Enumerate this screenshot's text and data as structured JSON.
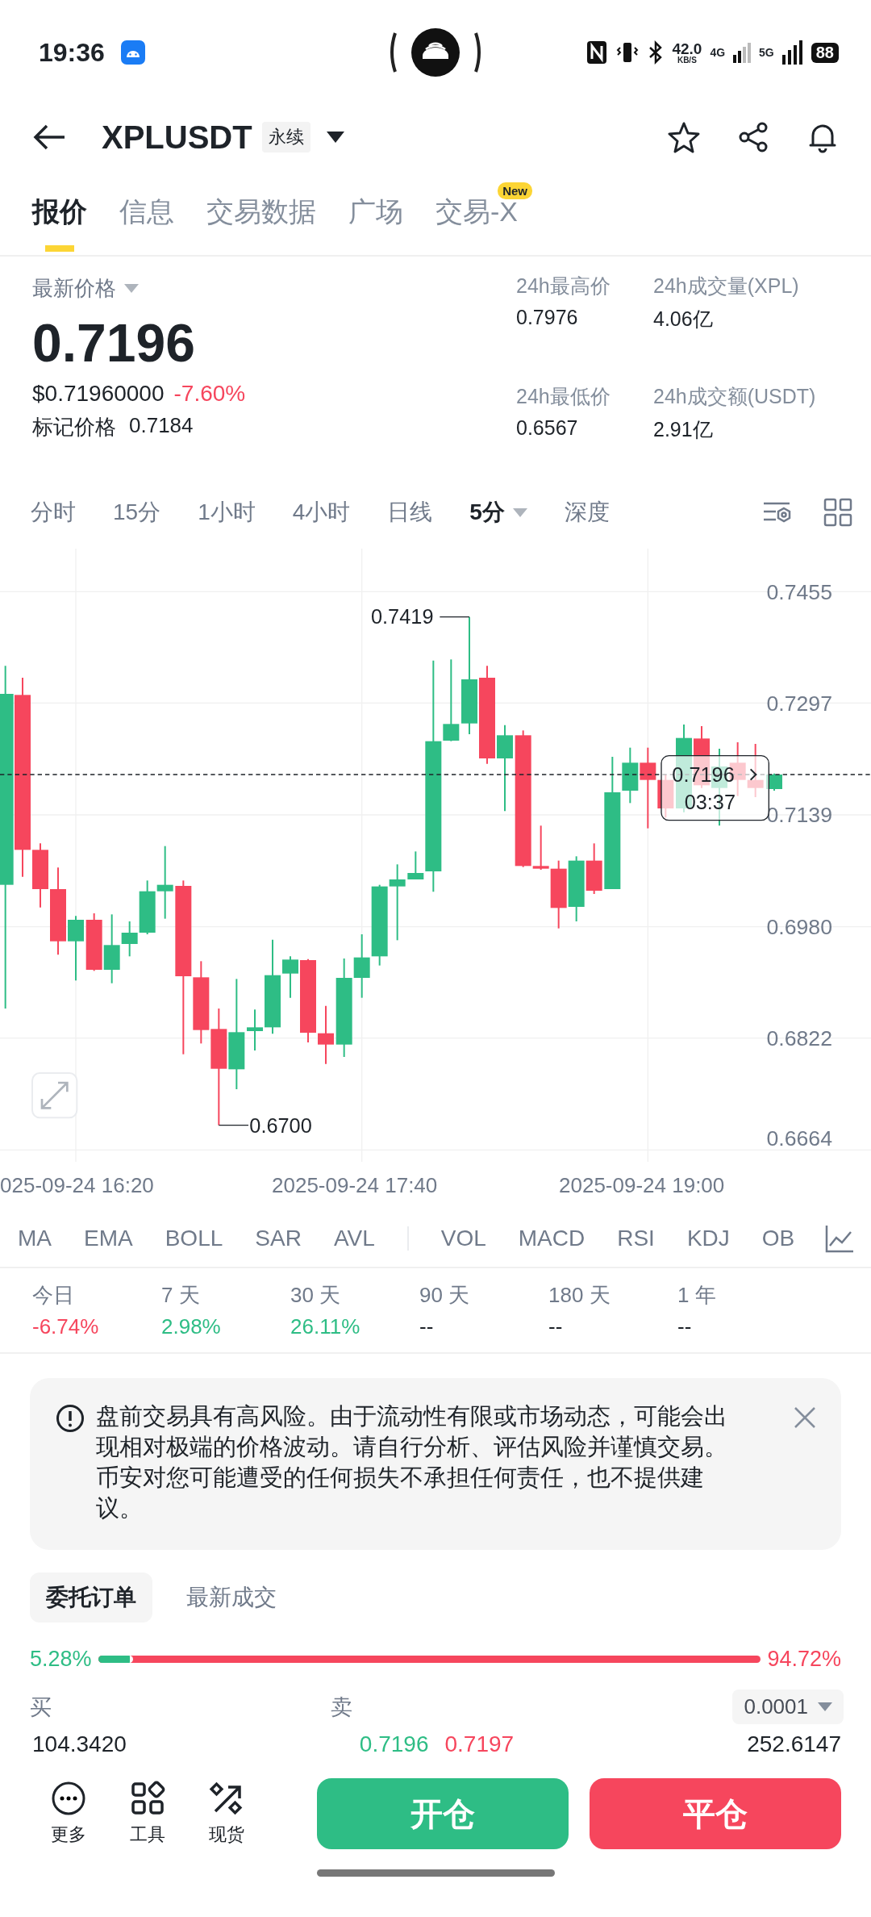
{
  "status_bar": {
    "time": "19:36",
    "speed": "42.0",
    "speed_unit": "KB/S",
    "network_1": "4G",
    "network_2": "5G",
    "battery": "88"
  },
  "header": {
    "symbol": "XPLUSDT",
    "tag": "永续"
  },
  "tabs": [
    {
      "label": "报价",
      "selected": true
    },
    {
      "label": "信息",
      "selected": false
    },
    {
      "label": "交易数据",
      "selected": false
    },
    {
      "label": "广场",
      "selected": false
    },
    {
      "label": "交易-X",
      "selected": false,
      "badge": "New"
    }
  ],
  "price": {
    "label": "最新价格",
    "last": "0.7196",
    "usd": "$0.71960000",
    "change": "-7.60%",
    "mark_label": "标记价格",
    "mark": "0.7184"
  },
  "stats": [
    {
      "label": "24h最高价",
      "value": "0.7976"
    },
    {
      "label": "24h成交量(XPL)",
      "value": "4.06亿"
    },
    {
      "label": "24h最低价",
      "value": "0.6567"
    },
    {
      "label": "24h成交额(USDT)",
      "value": "2.91亿"
    }
  ],
  "intervals": [
    {
      "label": "分时",
      "selected": false
    },
    {
      "label": "15分",
      "selected": false
    },
    {
      "label": "1小时",
      "selected": false
    },
    {
      "label": "4小时",
      "selected": false
    },
    {
      "label": "日线",
      "selected": false
    },
    {
      "label": "5分",
      "selected": true,
      "dropdown": true
    },
    {
      "label": "深度",
      "selected": false
    }
  ],
  "chart": {
    "y_labels": [
      "0.7455",
      "0.7297",
      "0.7139",
      "0.6980",
      "0.6822",
      "0.6664"
    ],
    "x_labels": [
      "025-09-24 16:20",
      "2025-09-24 17:40",
      "2025-09-24 19:00"
    ],
    "high_label": "0.7419",
    "low_label": "0.6700",
    "current_price": "0.7196",
    "countdown": "03:37"
  },
  "indicators_main": [
    "MA",
    "EMA",
    "BOLL",
    "SAR",
    "AVL"
  ],
  "indicators_sub": [
    "VOL",
    "MACD",
    "RSI",
    "KDJ",
    "OB"
  ],
  "periods": [
    {
      "label": "今日",
      "value": "-6.74%",
      "color": "#f6465d"
    },
    {
      "label": "7 天",
      "value": "2.98%",
      "color": "#2ebd85"
    },
    {
      "label": "30 天",
      "value": "26.11%",
      "color": "#2ebd85"
    },
    {
      "label": "90 天",
      "value": "--",
      "color": "#1e2329"
    },
    {
      "label": "180 天",
      "value": "--",
      "color": "#1e2329"
    },
    {
      "label": "1 年",
      "value": "--",
      "color": "#1e2329"
    }
  ],
  "notice": {
    "text": "盘前交易具有高风险。由于流动性有限或市场动态，可能会出现相对极端的价格波动。请自行分析、评估风险并谨慎交易。币安对您可能遭受的任何损失不承担任何责任，也不提供建议。"
  },
  "order_tabs": [
    {
      "label": "委托订单",
      "selected": true
    },
    {
      "label": "最新成交",
      "selected": false
    }
  ],
  "ratio": {
    "buy": "5.28%",
    "sell": "94.72%",
    "level": 0.0528
  },
  "book": {
    "buy_label": "买",
    "sell_label": "卖",
    "precision": "0.0001",
    "rows": [
      {
        "bid_qty": "104.3420",
        "bid": "0.7196",
        "ask": "0.7197",
        "ask_qty": "252.6147"
      }
    ]
  },
  "bottom_nav": [
    {
      "label": "更多",
      "kind": "more"
    },
    {
      "label": "工具",
      "kind": "tools"
    },
    {
      "label": "现货",
      "kind": "spot"
    }
  ],
  "actions": [
    {
      "label": "开仓",
      "kind": "open"
    },
    {
      "label": "平仓",
      "kind": "close"
    }
  ]
}
